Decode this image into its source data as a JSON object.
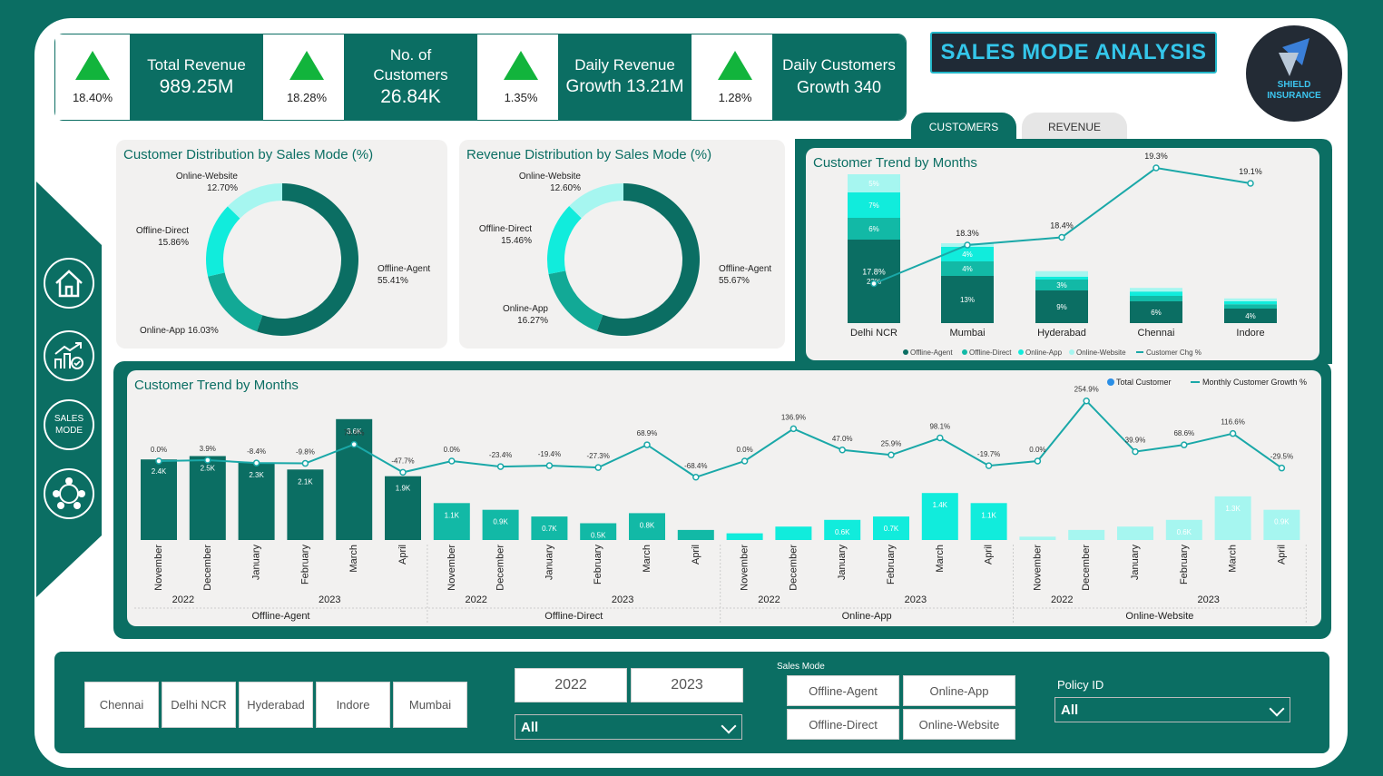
{
  "kpis": [
    {
      "pct": "18.40%",
      "title": "Total Revenue",
      "value": "989.25M"
    },
    {
      "pct": "18.28%",
      "title": "No. of Customers",
      "value": "26.84K"
    },
    {
      "pct": "1.35%",
      "title": "Daily Revenue",
      "value": "Growth 13.21M"
    },
    {
      "pct": "1.28%",
      "title": "Daily Customers",
      "value": "Growth 340"
    }
  ],
  "title": "SALES MODE ANALYSIS",
  "logo": {
    "line1": "SHIELD",
    "line2": "INSURANCE"
  },
  "nav": {
    "sales_mode": "SALES\nMODE"
  },
  "tabs": {
    "customers": "CUSTOMERS",
    "revenue": "REVENUE"
  },
  "cust_dist": {
    "title": "Customer Distribution by Sales Mode (%)",
    "labels": [
      {
        "name": "Online-Website",
        "value": "12.70%"
      },
      {
        "name": "Offline-Direct",
        "value": "15.86%"
      },
      {
        "name": "Online-App",
        "value": "16.03%"
      },
      {
        "name": "Offline-Agent",
        "value": "55.41%"
      }
    ]
  },
  "rev_dist": {
    "title": "Revenue Distribution by Sales Mode (%)",
    "labels": [
      {
        "name": "Online-Website",
        "value": "12.60%"
      },
      {
        "name": "Offline-Direct",
        "value": "15.46%"
      },
      {
        "name": "Online-App",
        "value": "16.27%"
      },
      {
        "name": "Offline-Agent",
        "value": "55.67%"
      }
    ]
  },
  "chart_data": [
    {
      "type": "pie",
      "title": "Customer Distribution by Sales Mode (%)",
      "categories": [
        "Offline-Agent",
        "Online-App",
        "Offline-Direct",
        "Online-Website"
      ],
      "values": [
        55.41,
        16.03,
        15.86,
        12.7
      ],
      "colors": [
        "#0b6e63",
        "#12a996",
        "#11ecdc",
        "#a6f6f0"
      ]
    },
    {
      "type": "pie",
      "title": "Revenue Distribution by Sales Mode (%)",
      "categories": [
        "Offline-Agent",
        "Online-App",
        "Offline-Direct",
        "Online-Website"
      ],
      "values": [
        55.67,
        16.27,
        15.46,
        12.6
      ],
      "colors": [
        "#0b6e63",
        "#12a996",
        "#11ecdc",
        "#a6f6f0"
      ]
    },
    {
      "type": "bar",
      "title": "Customer Trend by Months",
      "categories": [
        "Delhi NCR",
        "Mumbai",
        "Hyderabad",
        "Chennai",
        "Indore"
      ],
      "series": [
        {
          "name": "Offline-Agent",
          "values": [
            23,
            13,
            9,
            6,
            4
          ],
          "labels": [
            "23%",
            "13%",
            "9%",
            "6%",
            "4%"
          ]
        },
        {
          "name": "Offline-Direct",
          "values": [
            6,
            4,
            3,
            1.5,
            1.2
          ],
          "labels": [
            "6%",
            "4%",
            "3%",
            "",
            ""
          ]
        },
        {
          "name": "Online-App",
          "values": [
            7,
            4,
            0.8,
            1.2,
            0.8
          ],
          "labels": [
            "7%",
            "4%",
            "",
            "",
            ""
          ]
        },
        {
          "name": "Online-Website",
          "values": [
            5,
            1,
            1.5,
            1,
            0.8
          ],
          "labels": [
            "5%",
            "",
            "",
            "",
            ""
          ]
        }
      ],
      "line": {
        "name": "Customer Chg %",
        "values": [
          17.8,
          18.3,
          18.4,
          19.3,
          19.1
        ],
        "labels": [
          "17.8%",
          "18.3%",
          "18.4%",
          "19.3%",
          "19.1%"
        ]
      },
      "legend": [
        "Offline-Agent",
        "Offline-Direct",
        "Online-App",
        "Online-Website",
        "Customer Chg %"
      ]
    },
    {
      "type": "bar",
      "title": "Customer Trend by Months",
      "groups": [
        "Offline-Agent",
        "Offline-Direct",
        "Online-App",
        "Online-Website"
      ],
      "months": [
        "November",
        "December",
        "January",
        "February",
        "March",
        "April"
      ],
      "year_labels": [
        "2022",
        "2023"
      ],
      "series": [
        {
          "name": "Total Customer",
          "values": [
            2.4,
            2.5,
            2.3,
            2.1,
            3.6,
            1.9,
            1.1,
            0.9,
            0.7,
            0.5,
            0.8,
            0.3,
            0.2,
            0.4,
            0.6,
            0.7,
            1.4,
            1.1,
            0.1,
            0.3,
            0.4,
            0.6,
            1.3,
            0.9
          ],
          "labels": [
            "2.4K",
            "2.5K",
            "2.3K",
            "2.1K",
            "3.6K",
            "1.9K",
            "1.1K",
            "0.9K",
            "0.7K",
            "0.5K",
            "0.8K",
            "",
            "",
            "",
            "0.6K",
            "0.7K",
            "1.4K",
            "1.1K",
            "",
            "",
            "",
            "0.6K",
            "1.3K",
            "0.9K"
          ]
        },
        {
          "name": "Monthly Customer Growth %",
          "values": [
            0.0,
            3.9,
            -8.4,
            -9.8,
            70.6,
            -47.7,
            0.0,
            -23.4,
            -19.4,
            -27.3,
            68.9,
            -68.4,
            0.0,
            136.9,
            47.0,
            25.9,
            98.1,
            -19.7,
            0.0,
            254.9,
            39.9,
            68.6,
            116.6,
            -29.5
          ],
          "labels": [
            "0.0%",
            "3.9%",
            "-8.4%",
            "-9.8%",
            "70.6%",
            "-47.7%",
            "0.0%",
            "-23.4%",
            "-19.4%",
            "-27.3%",
            "68.9%",
            "-68.4%",
            "0.0%",
            "136.9%",
            "47.0%",
            "25.9%",
            "98.1%",
            "-19.7%",
            "0.0%",
            "254.9%",
            "39.9%",
            "68.6%",
            "116.6%",
            "-29.5%"
          ]
        }
      ],
      "colors": [
        "#0b6e63",
        "#12b9a6",
        "#11ecdc",
        "#a6f6f0"
      ],
      "legend": [
        "Total Customer",
        "Monthly Customer Growth %"
      ]
    }
  ],
  "filters": {
    "cities": [
      "Chennai",
      "Delhi NCR",
      "Hyderabad",
      "Indore",
      "Mumbai"
    ],
    "years": [
      "2022",
      "2023"
    ],
    "year_select": "All",
    "sales_mode_label": "Sales Mode",
    "sales_modes": [
      "Offline-Agent",
      "Online-App",
      "Offline-Direct",
      "Online-Website"
    ],
    "policy_label": "Policy ID",
    "policy_select": "All"
  }
}
